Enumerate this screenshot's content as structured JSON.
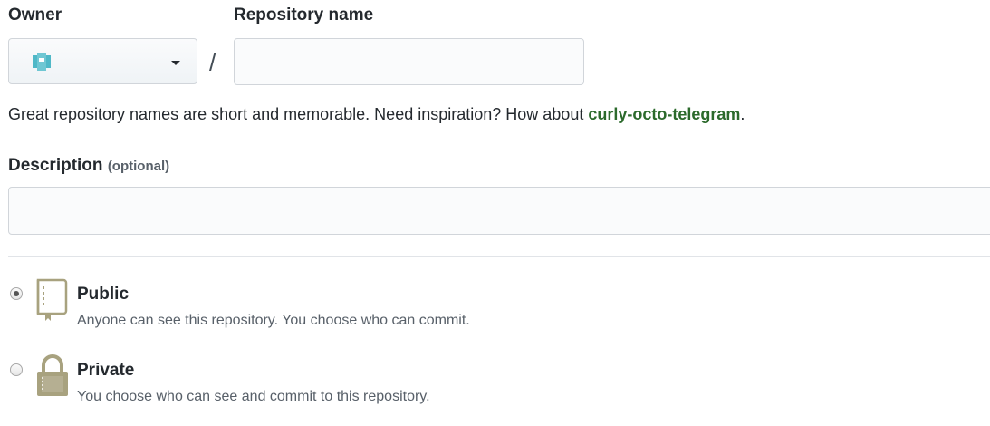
{
  "owner": {
    "label": "Owner",
    "selected_value": "",
    "avatar_icon": "identicon-avatar",
    "avatar_color": "#4fb8c7"
  },
  "repo": {
    "label": "Repository name",
    "value": "",
    "separator": "/"
  },
  "hint": {
    "text_before": "Great repository names are short and memorable. Need inspiration? How about ",
    "suggestion": "curly-octo-telegram",
    "text_after": "."
  },
  "description": {
    "label": "Description",
    "optional_tag": "(optional)",
    "value": ""
  },
  "visibility": {
    "selected": "public",
    "options": [
      {
        "id": "public",
        "title": "Public",
        "description": "Anyone can see this repository. You choose who can commit.",
        "icon": "repo-book-icon"
      },
      {
        "id": "private",
        "title": "Private",
        "description": "You choose who can see and commit to this repository.",
        "icon": "lock-icon"
      }
    ]
  },
  "colors": {
    "suggestion": "#2c6a2c",
    "icon": "#a8a27f"
  }
}
